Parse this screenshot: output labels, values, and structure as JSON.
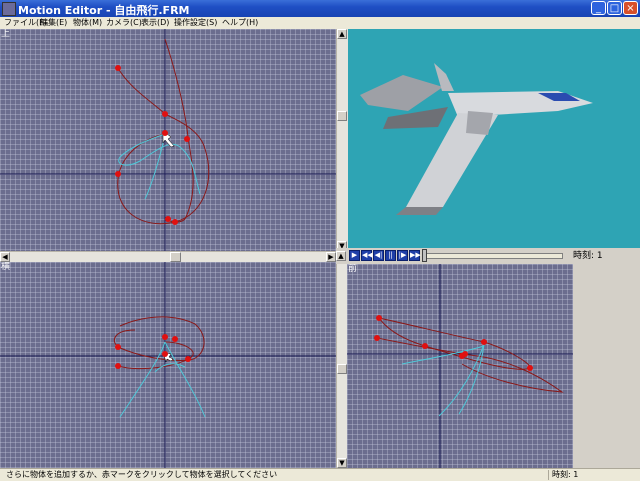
{
  "window": {
    "title": "Motion Editor - 自由飛行.FRM",
    "buttons": {
      "minimize": "_",
      "maximize": "□",
      "close": "×"
    }
  },
  "menu": [
    {
      "label": "ファイル(F)"
    },
    {
      "label": "編集(E)"
    },
    {
      "label": "物体(M)"
    },
    {
      "label": "カメラ(C)"
    },
    {
      "label": "表示(D)"
    },
    {
      "label": "操作設定(S)"
    },
    {
      "label": "ヘルプ(H)"
    }
  ],
  "views": {
    "top": {
      "label": "上"
    },
    "side": {
      "label": "横"
    },
    "front": {
      "label": "前"
    }
  },
  "playback": {
    "buttons": [
      "play",
      "rewind",
      "step-back",
      "pause",
      "step-forward",
      "fast-forward"
    ],
    "time_label": "時刻: 1",
    "position": 0.0
  },
  "status": {
    "message": "さらに物体を追加するか、赤マークをクリックして物体を選択してください",
    "time": "時刻: 1"
  },
  "colors": {
    "viewport_bg": "#6b6d8e",
    "preview_bg": "#2ea4b4",
    "curve_red": "#8a1818",
    "curve_cyan": "#4ec8d8",
    "marker": "#e01010",
    "title_bar": "#1f4fc4"
  }
}
